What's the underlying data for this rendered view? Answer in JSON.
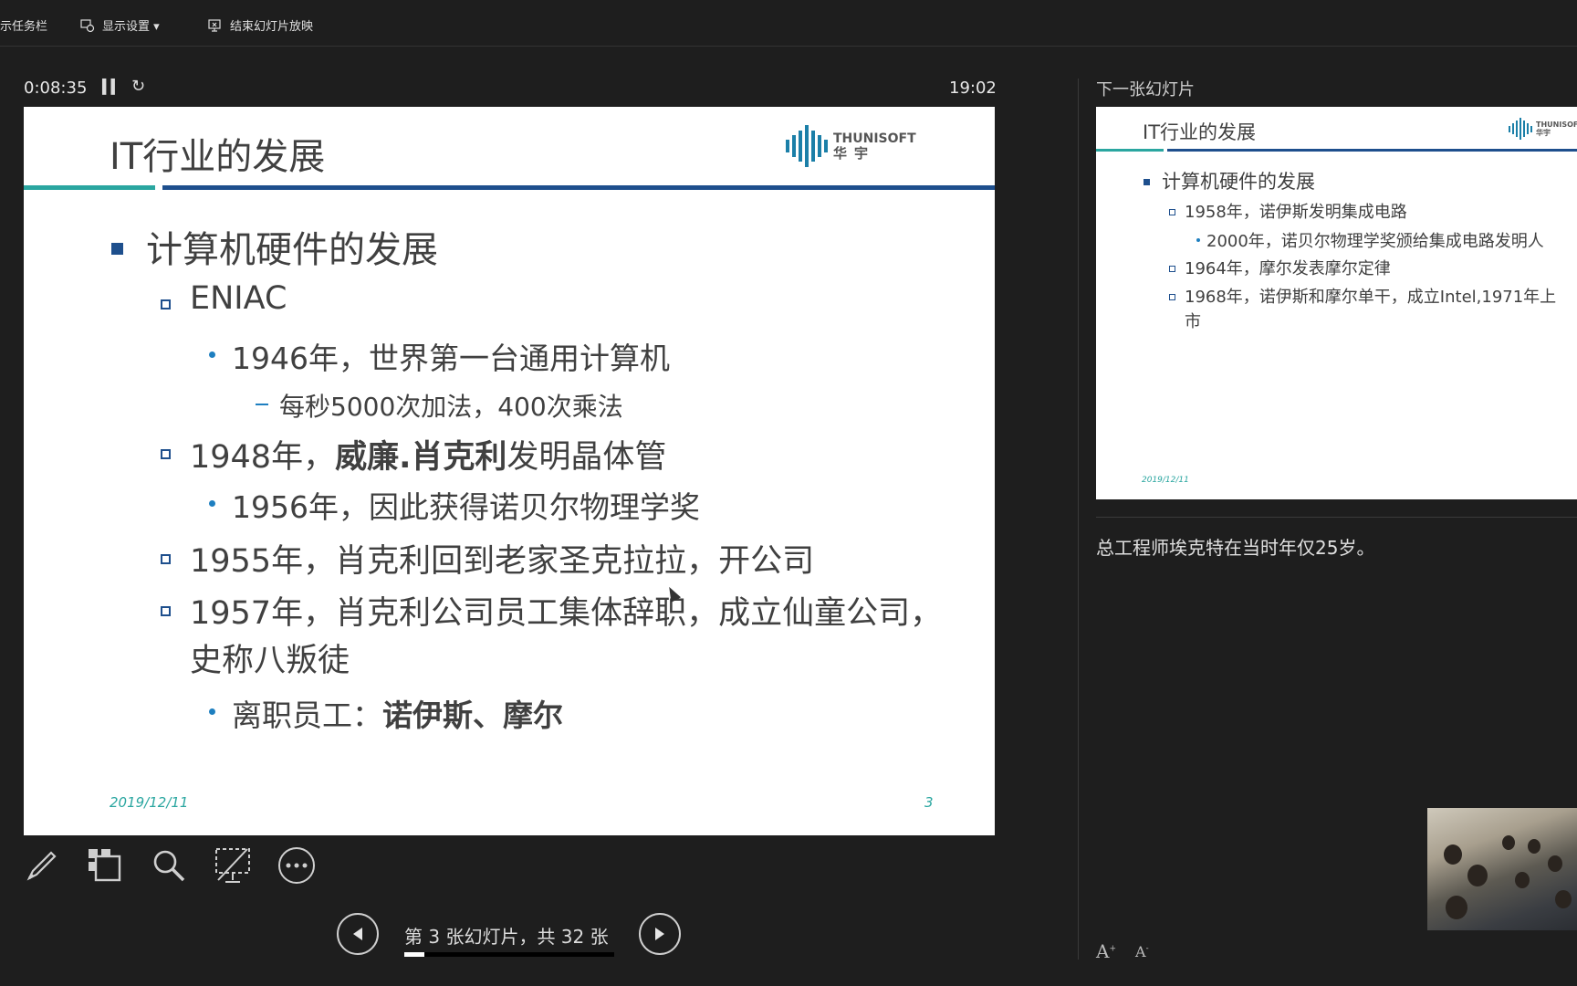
{
  "toolbar": {
    "taskbar_label": "示任务栏",
    "display_settings_label": "显示设置 ▾",
    "end_show_label": "结束幻灯片放映"
  },
  "presenter": {
    "elapsed": "0:08:35",
    "clock": "19:02"
  },
  "slide": {
    "title": "IT行业的发展",
    "logo_en": "THUNISOFT",
    "logo_cn": "华宇",
    "bullets": {
      "b1": "计算机硬件的发展",
      "b2": "ENIAC",
      "b3": "1946年，世界第一台通用计算机",
      "b4": "每秒5000次加法，400次乘法",
      "b5_pre": "1948年，",
      "b5_bold": "威廉.肖克利",
      "b5_post": "发明晶体管",
      "b6": "1956年，因此获得诺贝尔物理学奖",
      "b7": "1955年，肖克利回到老家圣克拉拉，开公司",
      "b8_line1": "1957年，肖克利公司员工集体辞职，成立仙童公司，",
      "b8_line2": "史称八叛徒",
      "b9_pre": "离职员工：",
      "b9_bold": "诺伊斯、摩尔"
    },
    "date": "2019/12/11",
    "number": "3"
  },
  "navigation": {
    "slide_counter": "第 3 张幻灯片，共 32 张",
    "progress": 0.094
  },
  "next_slide": {
    "label": "下一张幻灯片",
    "title": "IT行业的发展",
    "logo_en": "THUNISOFT",
    "logo_cn": "华宇",
    "bullets": {
      "b1": "计算机硬件的发展",
      "b2": "1958年，诺伊斯发明集成电路",
      "b3": "2000年，诺贝尔物理学奖颁给集成电路发明人",
      "b4": "1964年，摩尔发表摩尔定律",
      "b5_line1": "1968年，诺伊斯和摩尔单干，成立Intel,1971年上",
      "b5_line2": "市"
    },
    "date": "2019/12/11"
  },
  "notes": {
    "text": "总工程师埃克特在当时年仅25岁。"
  },
  "font_controls": {
    "increase": "A",
    "decrease": "A"
  },
  "colors": {
    "accent_blue": "#1e4f8d",
    "accent_teal": "#2aa6a0",
    "background": "#1e1e1e"
  }
}
